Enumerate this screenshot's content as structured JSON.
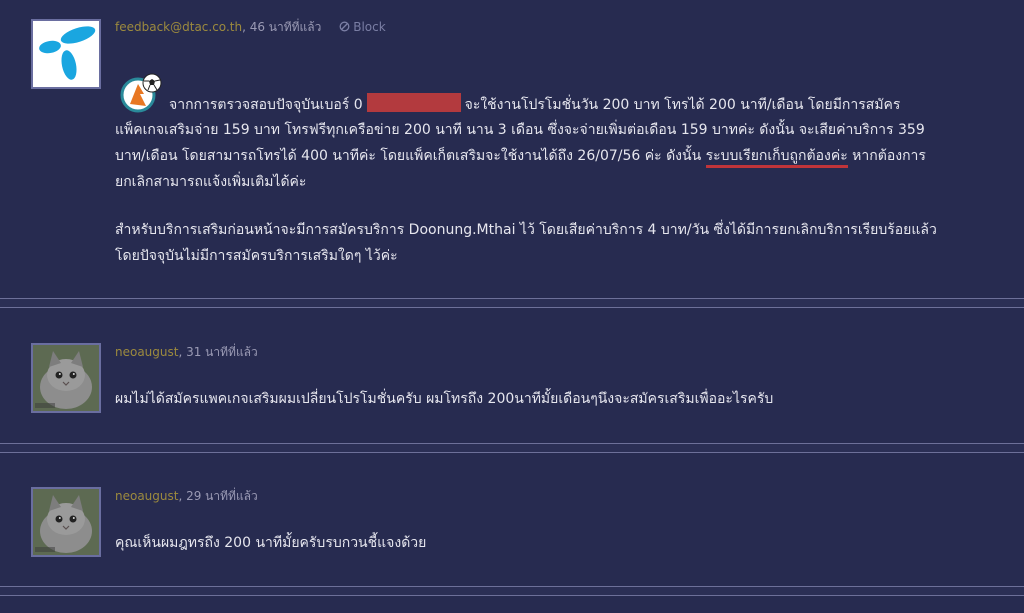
{
  "comments": [
    {
      "author": "feedback@dtac.co.th",
      "time": ", 46 นาทีที่แล้ว",
      "block_label": "Block",
      "avatar_icon": "dtac-logo-icon",
      "lines": [
        "จากการตรวจสอบปัจจุบันเบอร์ 0",
        "จะใช้งานโปรโมชั่นวัน  200 บาท โทรได้ 200 นาที/เดือน โดยมีการสมัคร",
        "แพ็คเกจเสริมจ่าย 159 บาท โทรฟรีทุกเครือข่าย 200 นาที นาน 3 เดือน ซึ่งจะจ่ายเพิ่มต่อเดือน 159 บาทค่ะ ดังนั้น จะเสียค่าบริการ 359",
        "บาท/เดือน  โดยสามารถโทรได้ 400 นาทีค่ะ โดยแพ็คเก็ตเสริมจะใช้งานได้ถึง 26/07/56 ค่ะ ดังนั้น",
        "ระบบเรียกเก็บถูกต้องค่ะ",
        "หากต้องการ",
        "ยกเลิกสามารถแจ้งเพิ่มเติมได้ค่ะ",
        "สำหรับบริการเสริมก่อนหน้าจะมีการสมัครบริการ  Doonung.Mthai ไว้ โดยเสียค่าบริการ 4 บาท/วัน ซึ่งได้มีการยกเลิกบริการเรียบร้อยแล้ว",
        "โดยปัจจุบันไม่มีการสมัครบริการเสริมใดๆ ไว้ค่ะ"
      ]
    },
    {
      "author": "neoaugust",
      "time": ", 31 นาทีที่แล้ว",
      "avatar_icon": "cat-avatar-icon",
      "lines": [
        "ผมไม่ได้สมัครแพคเกจเสริมผมเปลี่ยนโปรโมชั่นครับ ผมโทรถึง 200นาทีมั้ยเดือนๆนึงจะสมัครเสริมเพื่ออะไรครับ"
      ]
    },
    {
      "author": "neoaugust",
      "time": ", 29 นาทีที่แล้ว",
      "avatar_icon": "cat-avatar-icon",
      "lines": [
        "คุณเห็นผมฎทรถึง 200 นาทีมั้ยครับรบกวนชี้แจงด้วย"
      ]
    }
  ],
  "colors": {
    "background": "#272b50",
    "author": "#9c8a3e",
    "redaction": "#b33a3e",
    "underline": "#c0343a"
  }
}
